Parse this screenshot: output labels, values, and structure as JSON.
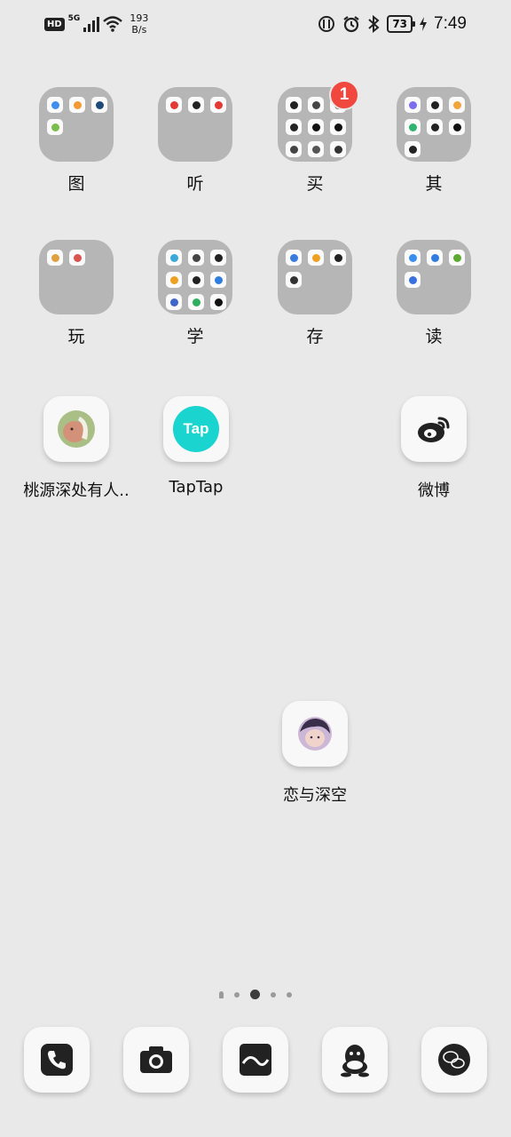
{
  "status_bar": {
    "hd": "HD",
    "network": "5G",
    "speed_value": "193",
    "speed_unit": "B/s",
    "battery": "73",
    "time": "7:49"
  },
  "folders": [
    {
      "label": "图",
      "apps": [
        "#3d8ef0",
        "#f39a33",
        "#1e4a7a",
        "#7bbd4a"
      ],
      "badge": ""
    },
    {
      "label": "听",
      "apps": [
        "#e53935",
        "#222222",
        "#e53935"
      ],
      "badge": ""
    },
    {
      "label": "买",
      "apps": [
        "#222222",
        "#444444",
        "#333333",
        "#222222",
        "#111111",
        "#111111",
        "#444444",
        "#555555",
        "#333333"
      ],
      "badge": "1"
    },
    {
      "label": "其",
      "apps": [
        "#7b6cf0",
        "#222222",
        "#f2a33a",
        "#2fb36e",
        "#222222",
        "#111111",
        "#222222"
      ],
      "badge": ""
    },
    {
      "label": "玩",
      "apps": [
        "#e0a040",
        "#d9534f"
      ],
      "badge": ""
    },
    {
      "label": "学",
      "apps": [
        "#3aa8d8",
        "#444444",
        "#222222",
        "#f0a020",
        "#222222",
        "#2f7de0",
        "#3f66c9",
        "#2fae5f",
        "#111111"
      ],
      "badge": ""
    },
    {
      "label": "存",
      "apps": [
        "#3a7be0",
        "#f0a020",
        "#222222",
        "#333333"
      ],
      "badge": ""
    },
    {
      "label": "读",
      "apps": [
        "#3a8ef0",
        "#2f7de0",
        "#5aaa2f",
        "#3a6fe0"
      ],
      "badge": ""
    }
  ],
  "apps": [
    {
      "label": "桃源深处有人..",
      "icon": "peach-spring-game-icon"
    },
    {
      "label": "TapTap",
      "icon": "taptap-icon",
      "glyph": "Tap"
    },
    {
      "label": "微博",
      "icon": "weibo-icon"
    },
    {
      "label": "恋与深空",
      "icon": "love-and-deepspace-icon"
    }
  ],
  "dock": [
    {
      "name": "phone",
      "icon": "phone-icon"
    },
    {
      "name": "camera",
      "icon": "camera-icon"
    },
    {
      "name": "gallery",
      "icon": "gallery-icon"
    },
    {
      "name": "qq",
      "icon": "qq-icon"
    },
    {
      "name": "wechat",
      "icon": "wechat-icon"
    }
  ],
  "pages": {
    "count": 5,
    "current": 2
  },
  "colors": {
    "background": "#e9e9e9",
    "folder": "#b6b6b6",
    "badge": "#f0483e",
    "taptap": "#19d4cf"
  }
}
